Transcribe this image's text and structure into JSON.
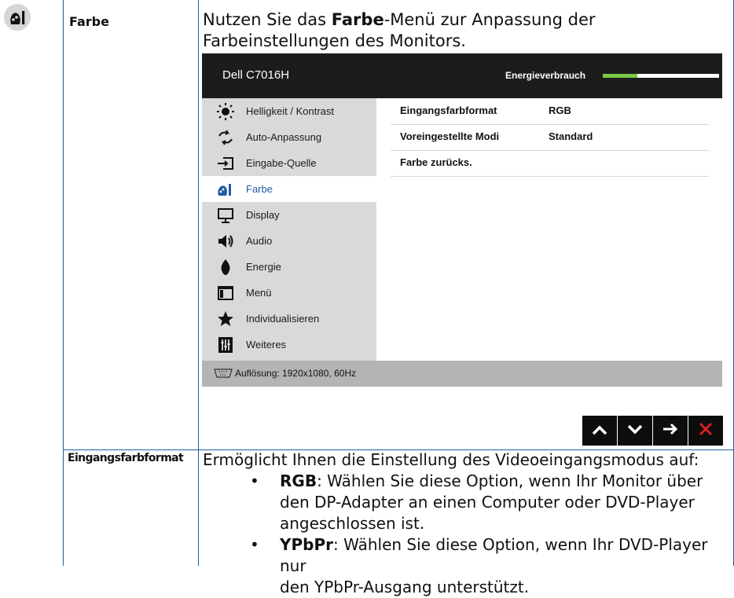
{
  "section": {
    "label": "Farbe",
    "intro_pre": "Nutzen Sie das ",
    "intro_bold": "Farbe",
    "intro_post": "-Menü zur Anpassung der",
    "intro_line2": "Farbeinstellungen des Monitors."
  },
  "osd": {
    "model": "Dell C7016H",
    "energy_label": "Energieverbrauch",
    "energy_level": 0.3,
    "menu": [
      {
        "label": "Helligkeit / Kontrast",
        "icon": "brightness-icon"
      },
      {
        "label": "Auto-Anpassung",
        "icon": "auto-adjust-icon"
      },
      {
        "label": "Eingabe-Quelle",
        "icon": "input-source-icon"
      },
      {
        "label": "Farbe",
        "icon": "color-icon",
        "selected": true
      },
      {
        "label": "Display",
        "icon": "display-icon"
      },
      {
        "label": "Audio",
        "icon": "audio-icon"
      },
      {
        "label": "Energie",
        "icon": "energy-icon"
      },
      {
        "label": "Menü",
        "icon": "menu-icon"
      },
      {
        "label": "Individualisieren",
        "icon": "star-icon"
      },
      {
        "label": "Weiteres",
        "icon": "others-icon"
      }
    ],
    "settings": [
      {
        "name": "Eingangsfarbformat",
        "value": "RGB"
      },
      {
        "name": "Voreingestellte Modi",
        "value": "Standard"
      },
      {
        "name": "Farbe zurücks.",
        "value": ""
      }
    ],
    "resolution": "Auflösung: 1920x1080, 60Hz",
    "nav_buttons": [
      "up-arrow-icon",
      "down-arrow-icon",
      "right-arrow-icon",
      "close-icon"
    ],
    "colors": {
      "energy_bar": "#7ac943",
      "close": "#e02020",
      "selected": "#1f5da6"
    }
  },
  "detail": {
    "label": "Eingangsfarbformat",
    "intro": "Ermöglicht Ihnen die Einstellung des Videoeingangsmodus auf:",
    "items": [
      {
        "bold": "RGB",
        "lines": [
          ": Wählen Sie diese Option, wenn Ihr Monitor über",
          "den DP-Adapter an einen Computer oder DVD-Player",
          "angeschlossen ist."
        ]
      },
      {
        "bold": "YPbPr",
        "lines": [
          ": Wählen Sie diese Option, wenn Ihr DVD-Player nur",
          "den YPbPr-Ausgang unterstützt."
        ]
      }
    ]
  }
}
